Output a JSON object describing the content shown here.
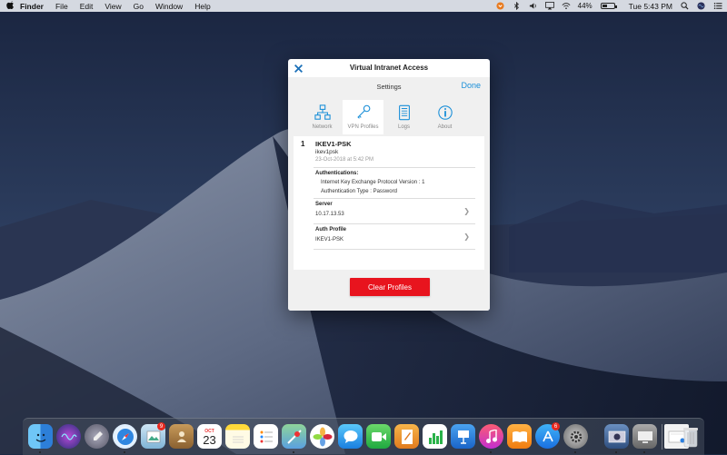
{
  "menubar": {
    "apple": "",
    "items": [
      "Finder",
      "File",
      "Edit",
      "View",
      "Go",
      "Window",
      "Help"
    ],
    "battery_percent": "44%",
    "battery_level": 0.44,
    "clock": "Tue 5:43 PM"
  },
  "dialog": {
    "title": "Virtual Intranet Access",
    "settings_title": "Settings",
    "done_label": "Done",
    "tabs": [
      {
        "label": "Network",
        "icon": "network-icon"
      },
      {
        "label": "VPN Profiles",
        "icon": "key-icon",
        "active": true
      },
      {
        "label": "Logs",
        "icon": "logs-icon"
      },
      {
        "label": "About",
        "icon": "info-icon"
      }
    ],
    "profile": {
      "number": "1",
      "name": "IKEV1-PSK",
      "username": "ikev1psk",
      "date": "23-Oct-2018 at 5:42 PM",
      "auth_heading": "Authentications:",
      "auth_lines": [
        "Internet Key Exchange Protocol Version : 1",
        "Authentication Type : Password"
      ],
      "server_label": "Server",
      "server_value": "10.17.13.53",
      "auth_profile_label": "Auth Profile",
      "auth_profile_value": "IKEV1-PSK"
    },
    "clear_label": "Clear Profiles",
    "accent": "#1a8fd8",
    "danger": "#e8141e"
  },
  "dock": {
    "calendar_month": "OCT",
    "calendar_day": "23",
    "badges": {
      "photos": "9",
      "appstore": "6"
    }
  }
}
